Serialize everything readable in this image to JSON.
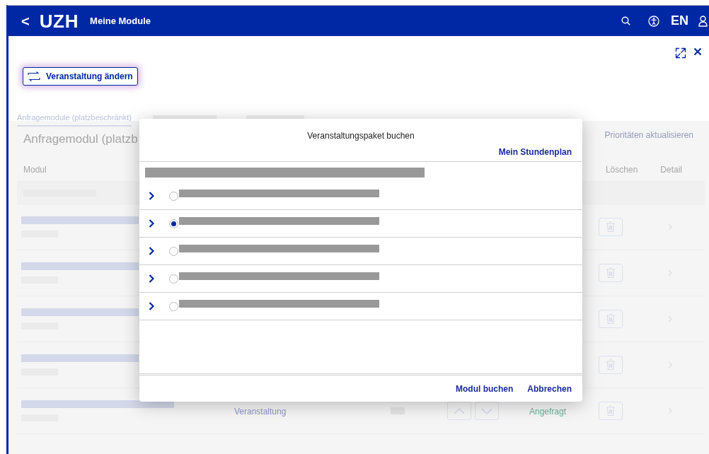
{
  "header": {
    "back": "<",
    "logo": "UZH",
    "title": "Meine Module",
    "language": "EN"
  },
  "change_button": "Veranstaltung ändern",
  "tabs": [
    {
      "label": "Anfragemodule (platzbeschränkt)",
      "selected": true
    }
  ],
  "section": {
    "heading": "Anfragemodul (platzb",
    "action": "Prioritäten aktualisieren"
  },
  "table": {
    "columns": [
      "Modul",
      "Löschen",
      "Detail"
    ],
    "rows": [
      {
        "kind": "covered"
      },
      {
        "kind": "covered"
      },
      {
        "kind": "covered"
      },
      {
        "kind": "covered"
      },
      {
        "kind": "full",
        "type": "Veranstaltung",
        "status": "Angefragt"
      }
    ]
  },
  "dialog": {
    "title": "Veranstaltungspaket buchen",
    "link": "Mein Stundenplan",
    "packages": [
      {
        "selected": false
      },
      {
        "selected": true
      },
      {
        "selected": false
      },
      {
        "selected": false
      },
      {
        "selected": false
      }
    ],
    "buttons": [
      "Modul buchen",
      "Abbrechen"
    ]
  }
}
